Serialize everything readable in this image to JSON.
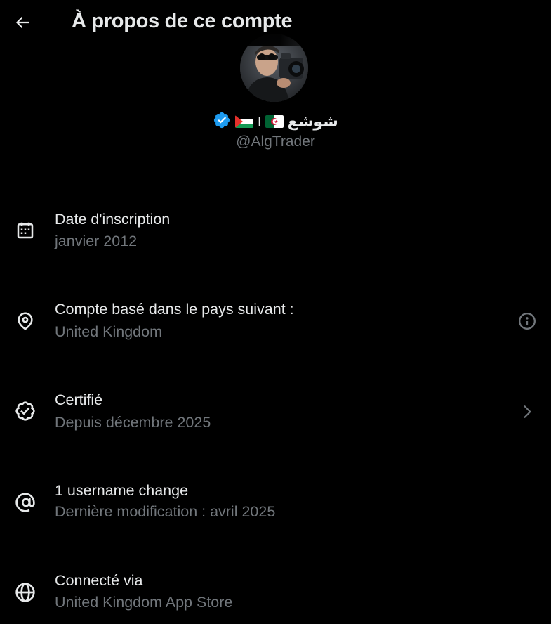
{
  "header": {
    "title": "À propos de ce compte",
    "back_icon": "arrow-left-icon"
  },
  "profile": {
    "display_name": "شوشع",
    "separator": "ا",
    "flags": [
      "algeria-flag",
      "palestine-flag"
    ],
    "verified_icon": "verified-badge-icon",
    "handle": "@AlgTrader"
  },
  "rows": [
    {
      "icon": "calendar-icon",
      "title": "Date d'inscription",
      "subtitle": "janvier 2012",
      "action_icon": null
    },
    {
      "icon": "location-pin-icon",
      "title": "Compte basé dans le pays suivant :",
      "subtitle": "United Kingdom",
      "action_icon": "info-icon"
    },
    {
      "icon": "verified-check-icon",
      "title": "Certifié",
      "subtitle": "Depuis décembre 2025",
      "action_icon": "chevron-right-icon"
    },
    {
      "icon": "at-sign-icon",
      "title": "1 username change",
      "subtitle": "Dernière modification : avril 2025",
      "action_icon": null
    },
    {
      "icon": "globe-icon",
      "title": "Connecté via",
      "subtitle": "United Kingdom App Store",
      "action_icon": null
    }
  ],
  "colors": {
    "background": "#000000",
    "text_primary": "#e7e9ea",
    "text_secondary": "#71767b",
    "verified_blue": "#1d9bf0"
  }
}
